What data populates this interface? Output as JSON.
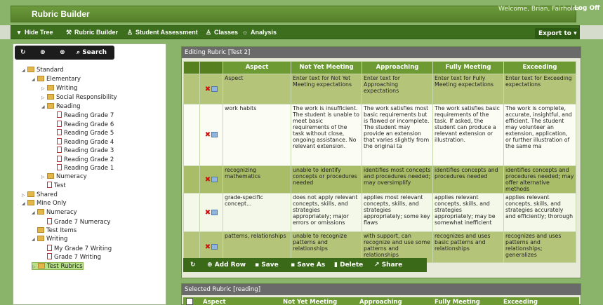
{
  "app": {
    "title": "Rubric Builder",
    "welcome": "Welcome, Brian, Fairholm",
    "logoff": "Log Off"
  },
  "menu": {
    "items": [
      {
        "label": "Hide Tree",
        "icon": "chevron-down-icon"
      },
      {
        "label": "Rubric Builder",
        "icon": "wrench-icon"
      },
      {
        "label": "Student Assessment",
        "icon": "user-icon"
      },
      {
        "label": "Classes",
        "icon": "user-icon"
      },
      {
        "label": "Analysis",
        "icon": "lightbulb-icon"
      }
    ],
    "export": "Export to"
  },
  "tree_toolbar": {
    "search": "Search"
  },
  "tree": [
    {
      "label": "Standard",
      "type": "folder"
    },
    {
      "label": "Elementary",
      "type": "folder"
    },
    {
      "label": "Writing",
      "type": "folder"
    },
    {
      "label": "Social Responsibility",
      "type": "folder"
    },
    {
      "label": "Reading",
      "type": "folder"
    },
    {
      "label": "Reading Grade 7",
      "type": "page"
    },
    {
      "label": "Reading Grade 6",
      "type": "page"
    },
    {
      "label": "Reading Grade 5",
      "type": "page"
    },
    {
      "label": "Reading Grade 4",
      "type": "page"
    },
    {
      "label": "Reading Grade 3",
      "type": "page"
    },
    {
      "label": "Reading Grade 2",
      "type": "page"
    },
    {
      "label": "Reading Grade 1",
      "type": "page"
    },
    {
      "label": "Numeracy",
      "type": "folder"
    },
    {
      "label": "Test",
      "type": "page"
    },
    {
      "label": "Shared",
      "type": "folder"
    },
    {
      "label": "Mine Only",
      "type": "folder"
    },
    {
      "label": "Numeracy",
      "type": "folder"
    },
    {
      "label": "Grade 7 Numeracy",
      "type": "page"
    },
    {
      "label": "Test Items",
      "type": "folder"
    },
    {
      "label": "Writing",
      "type": "folder"
    },
    {
      "label": "My Grade 7 Writing",
      "type": "page"
    },
    {
      "label": "Grade 7 Writing",
      "type": "page"
    },
    {
      "label": "Test Rubrics",
      "type": "folder"
    }
  ],
  "editing": {
    "title": "Editing Rubric [Test 2]",
    "headers": [
      "Aspect",
      "Not Yet Meeting",
      "Approaching",
      "Fully Meeting",
      "Exceeding"
    ],
    "rows": [
      [
        "Aspect",
        "Enter text for Not Yet Meeting expectations",
        "Enter text for Approaching expectations",
        "Enter text for Fully Meeting expectations",
        "Enter text for Exceeding expectations"
      ],
      [
        "work habits",
        "The work is insufficient. The student is unable to meet basic requirements of the task without close, ongoing assistance. No relevant extension.",
        "The work satisfies most basic requirements but is flawed or incomplete. The student may provide an extension that varies slightly from the original ta",
        "The work satisfies basic requirements of the task. If asked, the student can produce a relevant extension or illustration.",
        "The work is complete, accurate, insightful, and efficient. The student may volunteer an extension, application, or further illustration of the same ma"
      ],
      [
        "recognizing mathematics",
        "unable to identify concepts or procedures needed",
        "identifies most concepts and procedures needed; may oversimplify",
        "identifies concepts and procedures needed",
        "identifies concepts and procedures needed; may offer alternative methods"
      ],
      [
        "grade-specific concept...",
        "does not apply relevant concepts, skills, and strategies appropriately; major errors or omissions",
        "applies most relevant concepts, skills, and strategies appropriately; some key flaws",
        "applies relevant concepts, skills, and strategies appropriately; may be somewhat inefficient",
        "applies relevant concepts, skills, and strategies accurately and efficiently; thorough"
      ],
      [
        "patterns, relationships",
        "unable to recognize patterns and relationships",
        "with support, can recognize and use some patterns and relationships",
        "recognizes and uses basic patterns and relationships",
        "recognizes and uses patterns and relationships; generalizes"
      ]
    ],
    "buttons": {
      "add_row": "Add Row",
      "save": "Save",
      "save_as": "Save As",
      "delete": "Delete",
      "share": "Share"
    }
  },
  "selected": {
    "title": "Selected Rubric [reading]",
    "headers": [
      "Aspect",
      "Not Yet Meeting",
      "Approaching",
      "Fully Meeting",
      "Exceeding"
    ]
  }
}
